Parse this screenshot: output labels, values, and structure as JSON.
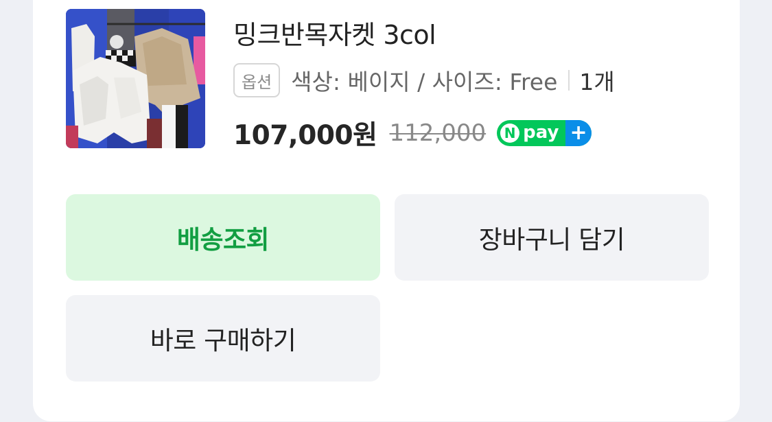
{
  "product": {
    "title": "밍크반목자켓 3col",
    "option_badge": "옵션",
    "option_text": "색상: 베이지 / 사이즈: Free",
    "quantity": "1개",
    "price": "107,000원",
    "original_price": "112,000",
    "npay_n": "N",
    "npay_text": "pay",
    "npay_plus": "+"
  },
  "actions": {
    "track_delivery": "배송조회",
    "add_to_cart": "장바구니 담기",
    "buy_now": "바로 구매하기"
  },
  "colors": {
    "naver_green": "#03c75a",
    "track_bg": "#dcf8e0",
    "track_text": "#129e42",
    "button_bg": "#f2f3f6"
  }
}
